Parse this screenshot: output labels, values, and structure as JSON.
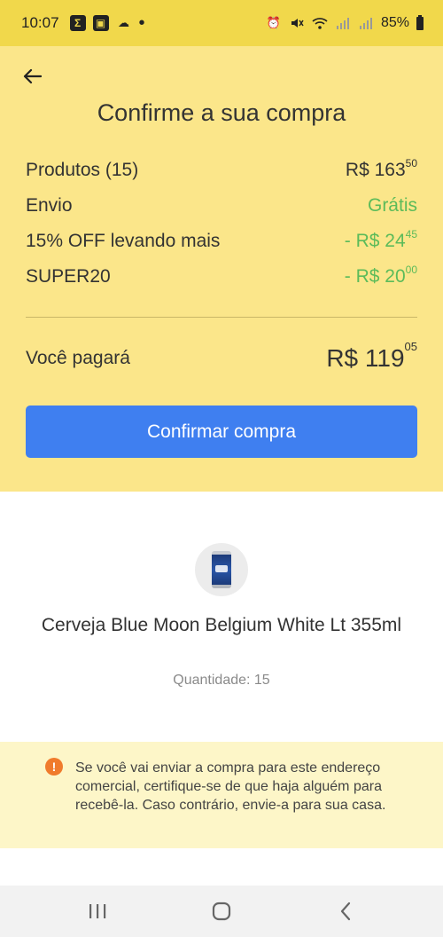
{
  "status_bar": {
    "time": "10:07",
    "battery": "85%",
    "left_icons": [
      "sigma-icon",
      "gallery-icon",
      "cloud-icon"
    ],
    "right_icons": [
      "alarm-icon",
      "mute-icon",
      "wifi-icon",
      "signal-icon",
      "signal-icon",
      "battery-icon"
    ]
  },
  "header": {
    "title": "Confirme a sua compra"
  },
  "summary": {
    "rows": [
      {
        "label": "Produtos (15)",
        "value_main": "R$ 163",
        "value_cents": "50",
        "color": "#333333"
      },
      {
        "label": "Envio",
        "value_main": "Grátis",
        "value_cents": "",
        "color": "#5cbb5a"
      },
      {
        "label": "15% OFF levando mais",
        "value_main": "- R$ 24",
        "value_cents": "45",
        "color": "#5cbb5a"
      },
      {
        "label": "SUPER20",
        "value_main": "- R$ 20",
        "value_cents": "00",
        "color": "#5cbb5a"
      }
    ],
    "total_label": "Você pagará",
    "total_main": "R$ 119",
    "total_cents": "05",
    "confirm_label": "Confirmar compra"
  },
  "product": {
    "name": "Cerveja Blue Moon Belgium White Lt 355ml",
    "quantity": "Quantidade: 15"
  },
  "notice": {
    "icon": "!",
    "text": "Se você vai enviar a compra para este endereço comercial, certifique-se de que haja alguém para recebê-la. Caso contrário, envie-a para sua casa."
  },
  "colors": {
    "brand_yellow": "#fbe68a",
    "status_yellow": "#f1d84b",
    "accent_blue": "#3f7ff0",
    "discount_green": "#5cbb5a",
    "warning_orange": "#f07b2c"
  }
}
